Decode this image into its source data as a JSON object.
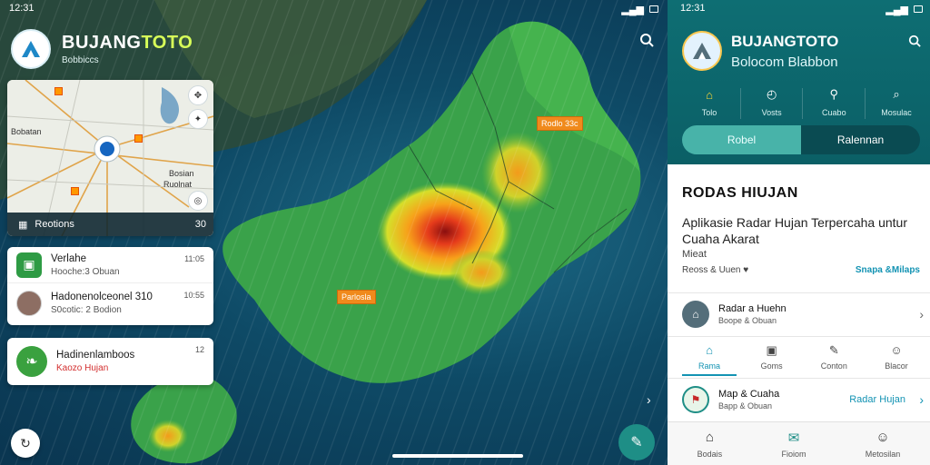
{
  "left_status": {
    "time": "12:31",
    "right_icons": "signal wifi battery"
  },
  "left_brand": {
    "title_part1": "BUJANG",
    "title_part2": "TOTO",
    "subtitle": "Bobbiccs"
  },
  "mini_map": {
    "labels": [
      "Bobatan",
      "Bosian",
      "Ruolnat"
    ],
    "footer_label": "Reotions",
    "footer_value": "30"
  },
  "cards": [
    {
      "title": "Verlahe",
      "subtitle": "Hooche:3 Obuan",
      "right": "11:05"
    },
    {
      "title": "Hadonenolceonel 310",
      "subtitle": "S0cotic: 2 Bodion",
      "right": "10:55"
    },
    {
      "title": "Hadinenlamboos",
      "subtitle": "Kaozo Hujan",
      "right": "12"
    }
  ],
  "map_tags": [
    "Rodlo 33c",
    "Parlosla"
  ],
  "right_status": {
    "time": "12:31",
    "right_icons": "signal wifi battery"
  },
  "right_brand": {
    "title": "BUJANGTOTO",
    "subtitle": "Bolocom Blabbon"
  },
  "top_tabs": [
    {
      "label": "Tolo",
      "icon": "⌂",
      "icon_name": "home-icon"
    },
    {
      "label": "Vosts",
      "icon": "◴",
      "icon_name": "clock-icon"
    },
    {
      "label": "Cuabo",
      "icon": "⚲",
      "icon_name": "share-icon"
    },
    {
      "label": "Mosulac",
      "icon": "⌕",
      "icon_name": "search-icon"
    }
  ],
  "segment": {
    "left": "Robel",
    "right": "Ralennan"
  },
  "hero": {
    "title": "RODAS HIUJAN",
    "description": "Aplikasie Radar Hujan Terpercaha untur Cuaha Akarat",
    "small": "Mieat",
    "meta_left": "Reoss & Uuen ♥",
    "meta_right": "Snapa &Milaps"
  },
  "list_items": [
    {
      "title": "Radar a Huehn",
      "subtitle": "Boope & Obuan"
    },
    {
      "title": "Map & Cuaha",
      "subtitle": "Bapp & Obuan",
      "link": "Radar Hujan"
    }
  ],
  "mid_tabs": [
    {
      "label": "Rama",
      "icon": "⌂",
      "icon_name": "home-icon"
    },
    {
      "label": "Goms",
      "icon": "▣",
      "icon_name": "grid-icon"
    },
    {
      "label": "Conton",
      "icon": "✎",
      "icon_name": "edit-icon"
    },
    {
      "label": "Blacor",
      "icon": "☺",
      "icon_name": "smile-icon"
    }
  ],
  "bottom_nav": [
    {
      "label": "Bodais",
      "icon": "⌂",
      "icon_name": "home-icon"
    },
    {
      "label": "Fioiom",
      "icon": "✉",
      "icon_name": "chat-icon"
    },
    {
      "label": "Metosilan",
      "icon": "☺",
      "icon_name": "profile-icon"
    }
  ],
  "colors": {
    "teal": "#0e6e73",
    "accent": "#1393b3",
    "orange": "#f08a1c",
    "brand_yellow": "#d8ff59"
  }
}
